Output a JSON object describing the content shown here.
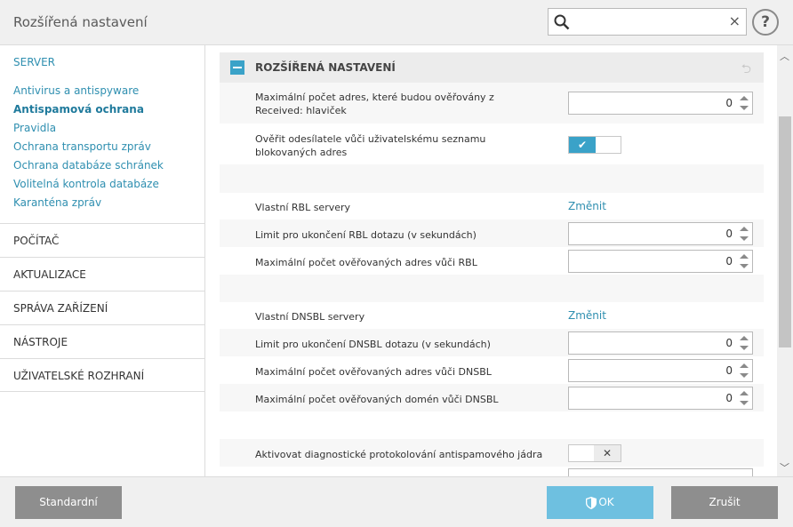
{
  "header": {
    "title": "Rozšířená nastavení",
    "search_value": "",
    "clear_glyph": "×",
    "help_glyph": "?"
  },
  "sidebar": {
    "server_label": "SERVER",
    "items": [
      "Antivirus a antispyware",
      "Antispamová ochrana",
      "Pravidla",
      "Ochrana transportu zpráv",
      "Ochrana databáze schránek",
      "Volitelná kontrola databáze",
      "Karanténa zpráv"
    ],
    "sections": [
      "POČÍTAČ",
      "AKTUALIZACE",
      "SPRÁVA ZAŘÍZENÍ",
      "NÁSTROJE",
      "UŽIVATELSKÉ ROZHRANÍ"
    ]
  },
  "main": {
    "section_title": "ROZŠÍŘENÁ NASTAVENÍ",
    "rows": {
      "max_received": {
        "label": "Maximální počet adres, které budou ověřovány z Received: hlaviček",
        "value": "0"
      },
      "verify_sender": {
        "label": "Ověřit odesílatele vůči uživatelskému seznamu blokovaných adres",
        "state": "on",
        "glyph": "✔"
      },
      "rbl_servers": {
        "label": "Vlastní RBL servery",
        "link": "Změnit"
      },
      "rbl_timeout": {
        "label": "Limit pro ukončení RBL dotazu (v sekundách)",
        "value": "0"
      },
      "rbl_max": {
        "label": "Maximální počet ověřovaných adres vůči RBL",
        "value": "0"
      },
      "dnsbl_servers": {
        "label": "Vlastní DNSBL servery",
        "link": "Změnit"
      },
      "dnsbl_timeout": {
        "label": "Limit pro ukončení DNSBL dotazu (v sekundách)",
        "value": "0"
      },
      "dnsbl_max_addr": {
        "label": "Maximální počet ověřovaných adres vůči DNSBL",
        "value": "0"
      },
      "dnsbl_max_domain": {
        "label": "Maximální počet ověřovaných domén vůči DNSBL",
        "value": "0"
      },
      "diag_logging": {
        "label": "Aktivovat diagnostické protokolování antispamového jádra",
        "state": "off",
        "glyph": "✕"
      }
    }
  },
  "footer": {
    "default_label": "Standardní",
    "ok_label": "OK",
    "cancel_label": "Zrušit"
  },
  "colors": {
    "accent": "#3aa2c8",
    "link": "#2f8fb0",
    "button_gray": "#8e8e8e",
    "button_ok": "#6ec0e0"
  }
}
